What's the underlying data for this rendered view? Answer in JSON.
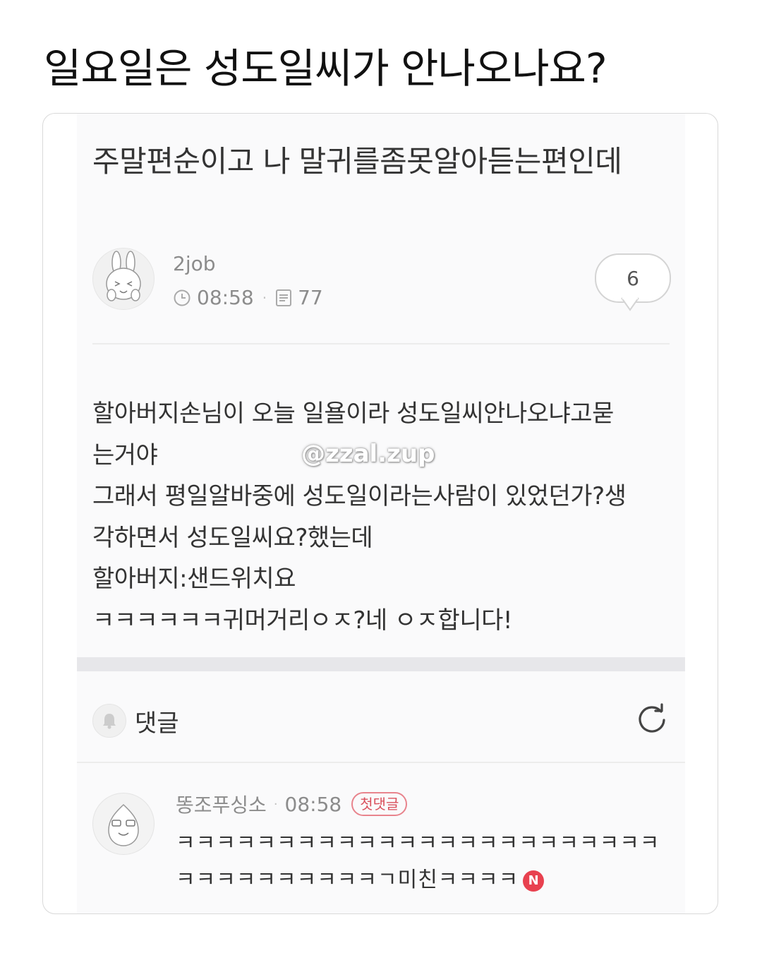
{
  "headline": "일요일은 성도일씨가 안나오나요?",
  "post": {
    "title": "주말편순이고 나 말귀를좀못알아듣는편인데",
    "author": "2job",
    "time": "08:58",
    "views": "77",
    "comment_count": "6",
    "body_lines": [
      "할아버지손님이 오늘 일욜이라 성도일씨안나오냐고묻",
      "는거야",
      "그래서 평일알바중에 성도일이라는사람이 있었던가?생",
      "각하면서 성도일씨요?했는데",
      "할아버지:샌드위치요",
      "ㅋㅋㅋㅋㅋㅋ귀머거리ㅇㅈ?네 ㅇㅈ합니다!"
    ]
  },
  "watermark": "@zzal.zup",
  "comments_section": {
    "label": "댓글"
  },
  "comment": {
    "author": "똥조푸싱소",
    "time": "08:58",
    "badge": "첫댓글",
    "lines": [
      "ㅋㅋㅋㅋㅋㅋㅋㅋㅋㅋㅋㅋㅋㅋㅋㅋㅋㅋㅋㅋㅋㅋㅋㅋ",
      "ㅋㅋㅋㅋㅋㅋㅋㅋㅋㅋㄱ미친ㅋㅋㅋㅋ"
    ],
    "new_badge": "N"
  },
  "colors": {
    "accent_red": "#e8414f",
    "muted_text": "#8c8c8c"
  },
  "icons": [
    "clock-icon",
    "document-icon",
    "speech-bubble-icon",
    "bell-icon",
    "refresh-icon",
    "rabbit-avatar",
    "peach-avatar"
  ]
}
